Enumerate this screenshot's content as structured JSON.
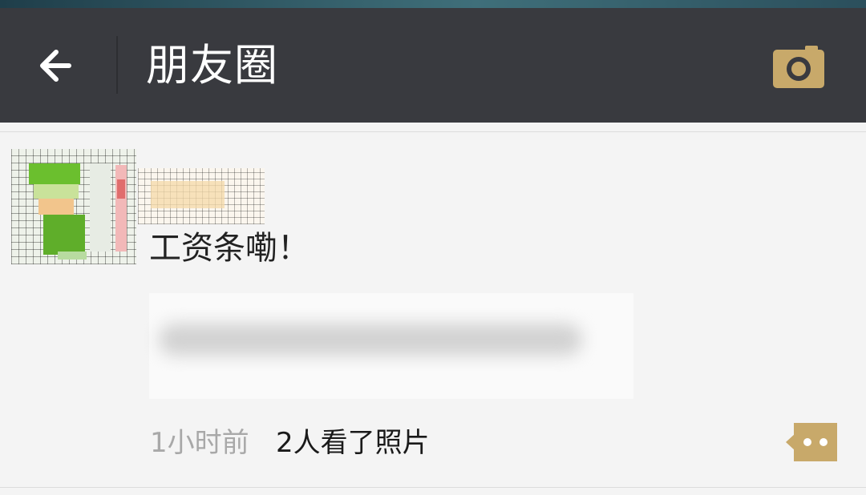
{
  "header": {
    "title": "朋友圈",
    "back_icon": "back-arrow-icon",
    "camera_icon": "camera-icon",
    "background": "#393a3f",
    "accent": "#c8a96a"
  },
  "post": {
    "avatar_icon": "pixelated-avatar",
    "text": "工资条嘞！",
    "timestamp": "1小时前",
    "view_count": "2人看了照片",
    "comment_icon": "comment-more-icon"
  }
}
